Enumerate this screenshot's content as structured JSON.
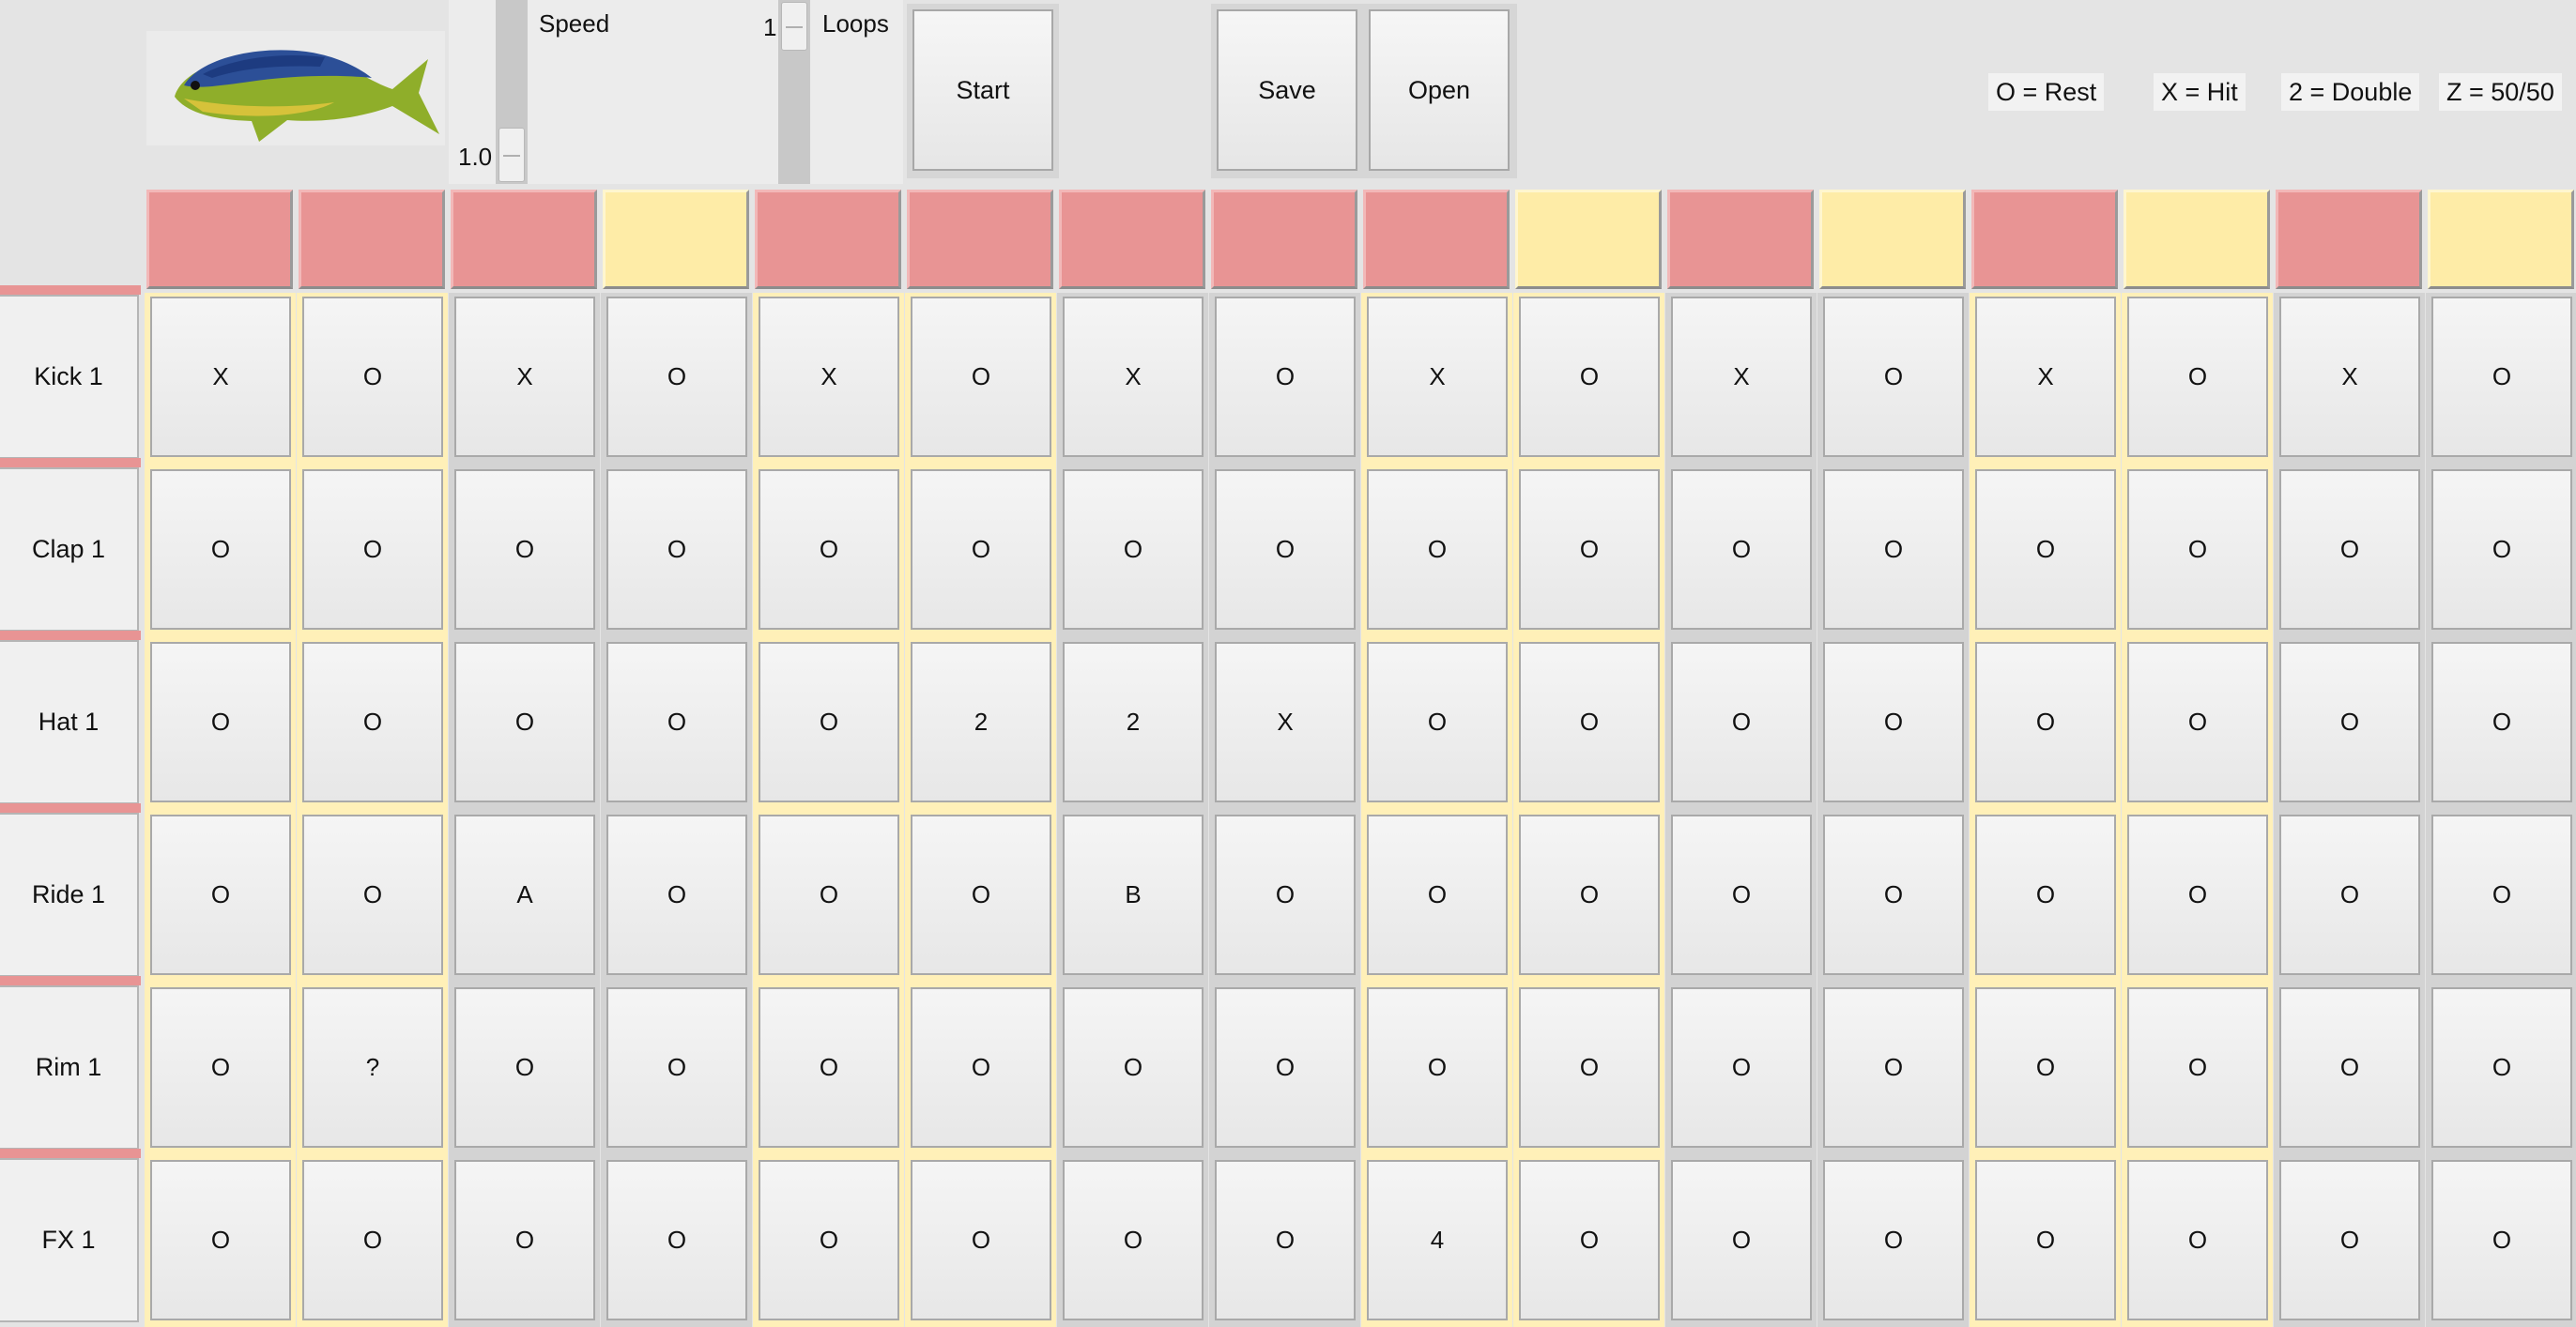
{
  "toolbar": {
    "speed_label": "Speed",
    "speed_value": "1.0",
    "loops_label": "Loops",
    "loops_value": "1",
    "start_label": "Start",
    "save_label": "Save",
    "open_label": "Open"
  },
  "legend": [
    "O = Rest",
    "X = Hit",
    "2 = Double",
    "Z = 50/50"
  ],
  "colors": {
    "active_red": "#e89494",
    "beat_yellow": "#feeca7"
  },
  "step_indicators": [
    "red",
    "red",
    "red",
    "yellow",
    "red",
    "red",
    "red",
    "red",
    "red",
    "yellow",
    "red",
    "yellow",
    "red",
    "yellow",
    "red",
    "yellow"
  ],
  "tracks": [
    {
      "name": "Kick 1",
      "steps": [
        "X",
        "O",
        "X",
        "O",
        "X",
        "O",
        "X",
        "O",
        "X",
        "O",
        "X",
        "O",
        "X",
        "O",
        "X",
        "O"
      ]
    },
    {
      "name": "Clap 1",
      "steps": [
        "O",
        "O",
        "O",
        "O",
        "O",
        "O",
        "O",
        "O",
        "O",
        "O",
        "O",
        "O",
        "O",
        "O",
        "O",
        "O"
      ]
    },
    {
      "name": "Hat 1",
      "steps": [
        "O",
        "O",
        "O",
        "O",
        "O",
        "2",
        "2",
        "X",
        "O",
        "O",
        "O",
        "O",
        "O",
        "O",
        "O",
        "O"
      ]
    },
    {
      "name": "Ride 1",
      "steps": [
        "O",
        "O",
        "A",
        "O",
        "O",
        "O",
        "B",
        "O",
        "O",
        "O",
        "O",
        "O",
        "O",
        "O",
        "O",
        "O"
      ]
    },
    {
      "name": "Rim 1",
      "steps": [
        "O",
        "?",
        "O",
        "O",
        "O",
        "O",
        "O",
        "O",
        "O",
        "O",
        "O",
        "O",
        "O",
        "O",
        "O",
        "O"
      ]
    },
    {
      "name": "FX 1",
      "steps": [
        "O",
        "O",
        "O",
        "O",
        "O",
        "O",
        "O",
        "O",
        "4",
        "O",
        "O",
        "O",
        "O",
        "O",
        "O",
        "O"
      ]
    }
  ]
}
